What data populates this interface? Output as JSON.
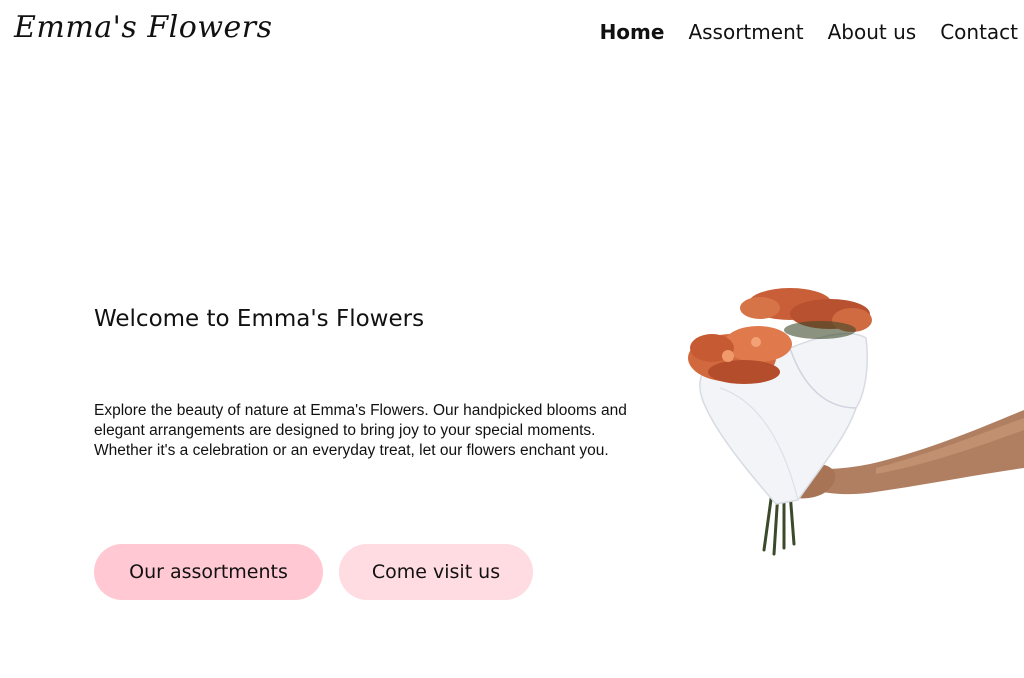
{
  "header": {
    "logo": "Emma's Flowers",
    "nav": [
      {
        "label": "Home",
        "active": true
      },
      {
        "label": "Assortment",
        "active": false
      },
      {
        "label": "About us",
        "active": false
      },
      {
        "label": "Contact",
        "active": false
      }
    ]
  },
  "hero": {
    "title": "Welcome to Emma's Flowers",
    "body": "Explore the beauty of nature at Emma's Flowers. Our handpicked blooms and elegant arrangements are designed to bring joy to your special moments. Whether it's a celebration or an everyday treat, let our flowers enchant you.",
    "buttons": {
      "assortments": "Our assortments",
      "visit": "Come visit us"
    }
  },
  "colors": {
    "primary_button": "#ffc8d3",
    "secondary_button": "#ffdbe2",
    "text": "#111111",
    "background": "#ffffff"
  },
  "images": {
    "hero": "bouquet-in-hand-illustration"
  }
}
